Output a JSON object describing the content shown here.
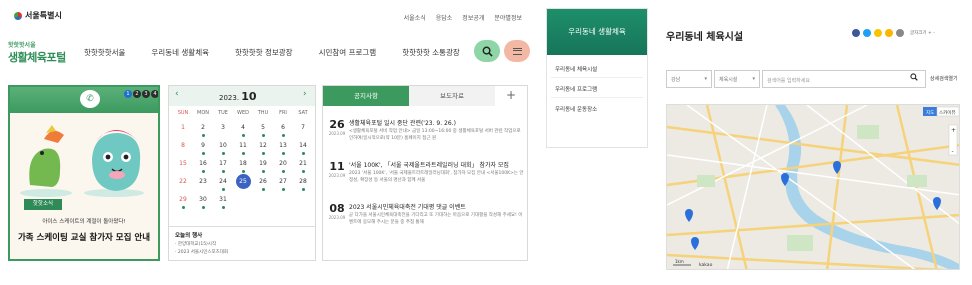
{
  "header": {
    "logo_text": "서울특별시",
    "top_links": [
      "서울소식",
      "응답소",
      "정보공개",
      "분야별정보"
    ]
  },
  "brand": {
    "small": "핫핫핫서울",
    "big": "생활체육포털"
  },
  "gnb": [
    "핫핫핫핫서울",
    "우리동네 생활체육",
    "핫핫핫핫 정보광장",
    "시민참여 프로그램",
    "핫핫핫핫 소통광장"
  ],
  "icons": {
    "search": "search-icon",
    "menu": "menu-icon",
    "megaphone": "megaphone-icon"
  },
  "colors": {
    "primary": "#3c9a5f",
    "accent_blue": "#3b63c4"
  },
  "promo": {
    "pages": [
      "1",
      "2",
      "3",
      "4"
    ],
    "tag": "핫핫소식",
    "subtitle": "아이스 스케이트의 계절이 돌아왔다!",
    "title": "가족 스케이팅 교실 참가자 모집 안내"
  },
  "calendar": {
    "year": "2023.",
    "month": "10",
    "weekdays": [
      "SUN",
      "MON",
      "TUE",
      "WED",
      "THU",
      "FRI",
      "SAT"
    ],
    "weeks": [
      [
        "1",
        "2",
        "3",
        "4",
        "5",
        "6",
        "7"
      ],
      [
        "8",
        "9",
        "10",
        "11",
        "12",
        "13",
        "14"
      ],
      [
        "15",
        "16",
        "17",
        "18",
        "19",
        "20",
        "21"
      ],
      [
        "22",
        "23",
        "24",
        "25",
        "26",
        "27",
        "28"
      ],
      [
        "29",
        "30",
        "31",
        "",
        "",
        "",
        ""
      ]
    ],
    "today": "25",
    "today_label": "오늘의 행사",
    "today_items": [
      "한양대학교(15)시작",
      "2023 서울시민스포츠대회"
    ]
  },
  "notice": {
    "tab_active": "공지사항",
    "tab_inactive": "보도자료",
    "plus": "+",
    "items": [
      {
        "day": "26",
        "date": "2023.09",
        "title": "생활체육포털 일시 중단 관련('23. 9. 26.)",
        "body": "<생활체육포털 서비 작업 안내> 금일 13:00~16:00 중 생활체육포털 서버 관련 작업으로 인하여(일시적으로(약 10분) 홈페이지 접근 원"
      },
      {
        "day": "11",
        "date": "2023.09",
        "title": "'서울 100K', 「서울 국제울트라트레일러닝 대회」 참가자 모집",
        "body": "2023 '서울 100K', '서울 국제울트라트레일러닝대회', 참가자 모집 안내 <서울100K>는 안정성, 확장성 등 서울의 명산과 함께 서울"
      },
      {
        "day": "08",
        "date": "2023.09",
        "title": "2023 서울시민체육대축전 기대평 댓글 이벤트",
        "body": "곧 다가올 서울시민체육대축전을 기다리고 또 기대하는 마음으로 기대평을 작성해 주세요! 이벤트에 응모해 주시는 분들 중 추첨 통해"
      }
    ]
  },
  "sidebar": {
    "title": "우리동네 생활체육",
    "items": [
      "우리동네 체육시설",
      "우리동네 프로그램",
      "우리동네 운동장소"
    ]
  },
  "facility": {
    "title": "우리동네 체육시설",
    "zoom_text": "글자크기 + -",
    "filter": {
      "district": "강남",
      "type": "체육시설",
      "search_placeholder": "검색어를 입력하세요",
      "detail": "상세검색열기"
    },
    "map_labels": {
      "mode1": "지도",
      "mode2": "스카이뷰",
      "scale": "1km",
      "brand": "kakao"
    }
  }
}
